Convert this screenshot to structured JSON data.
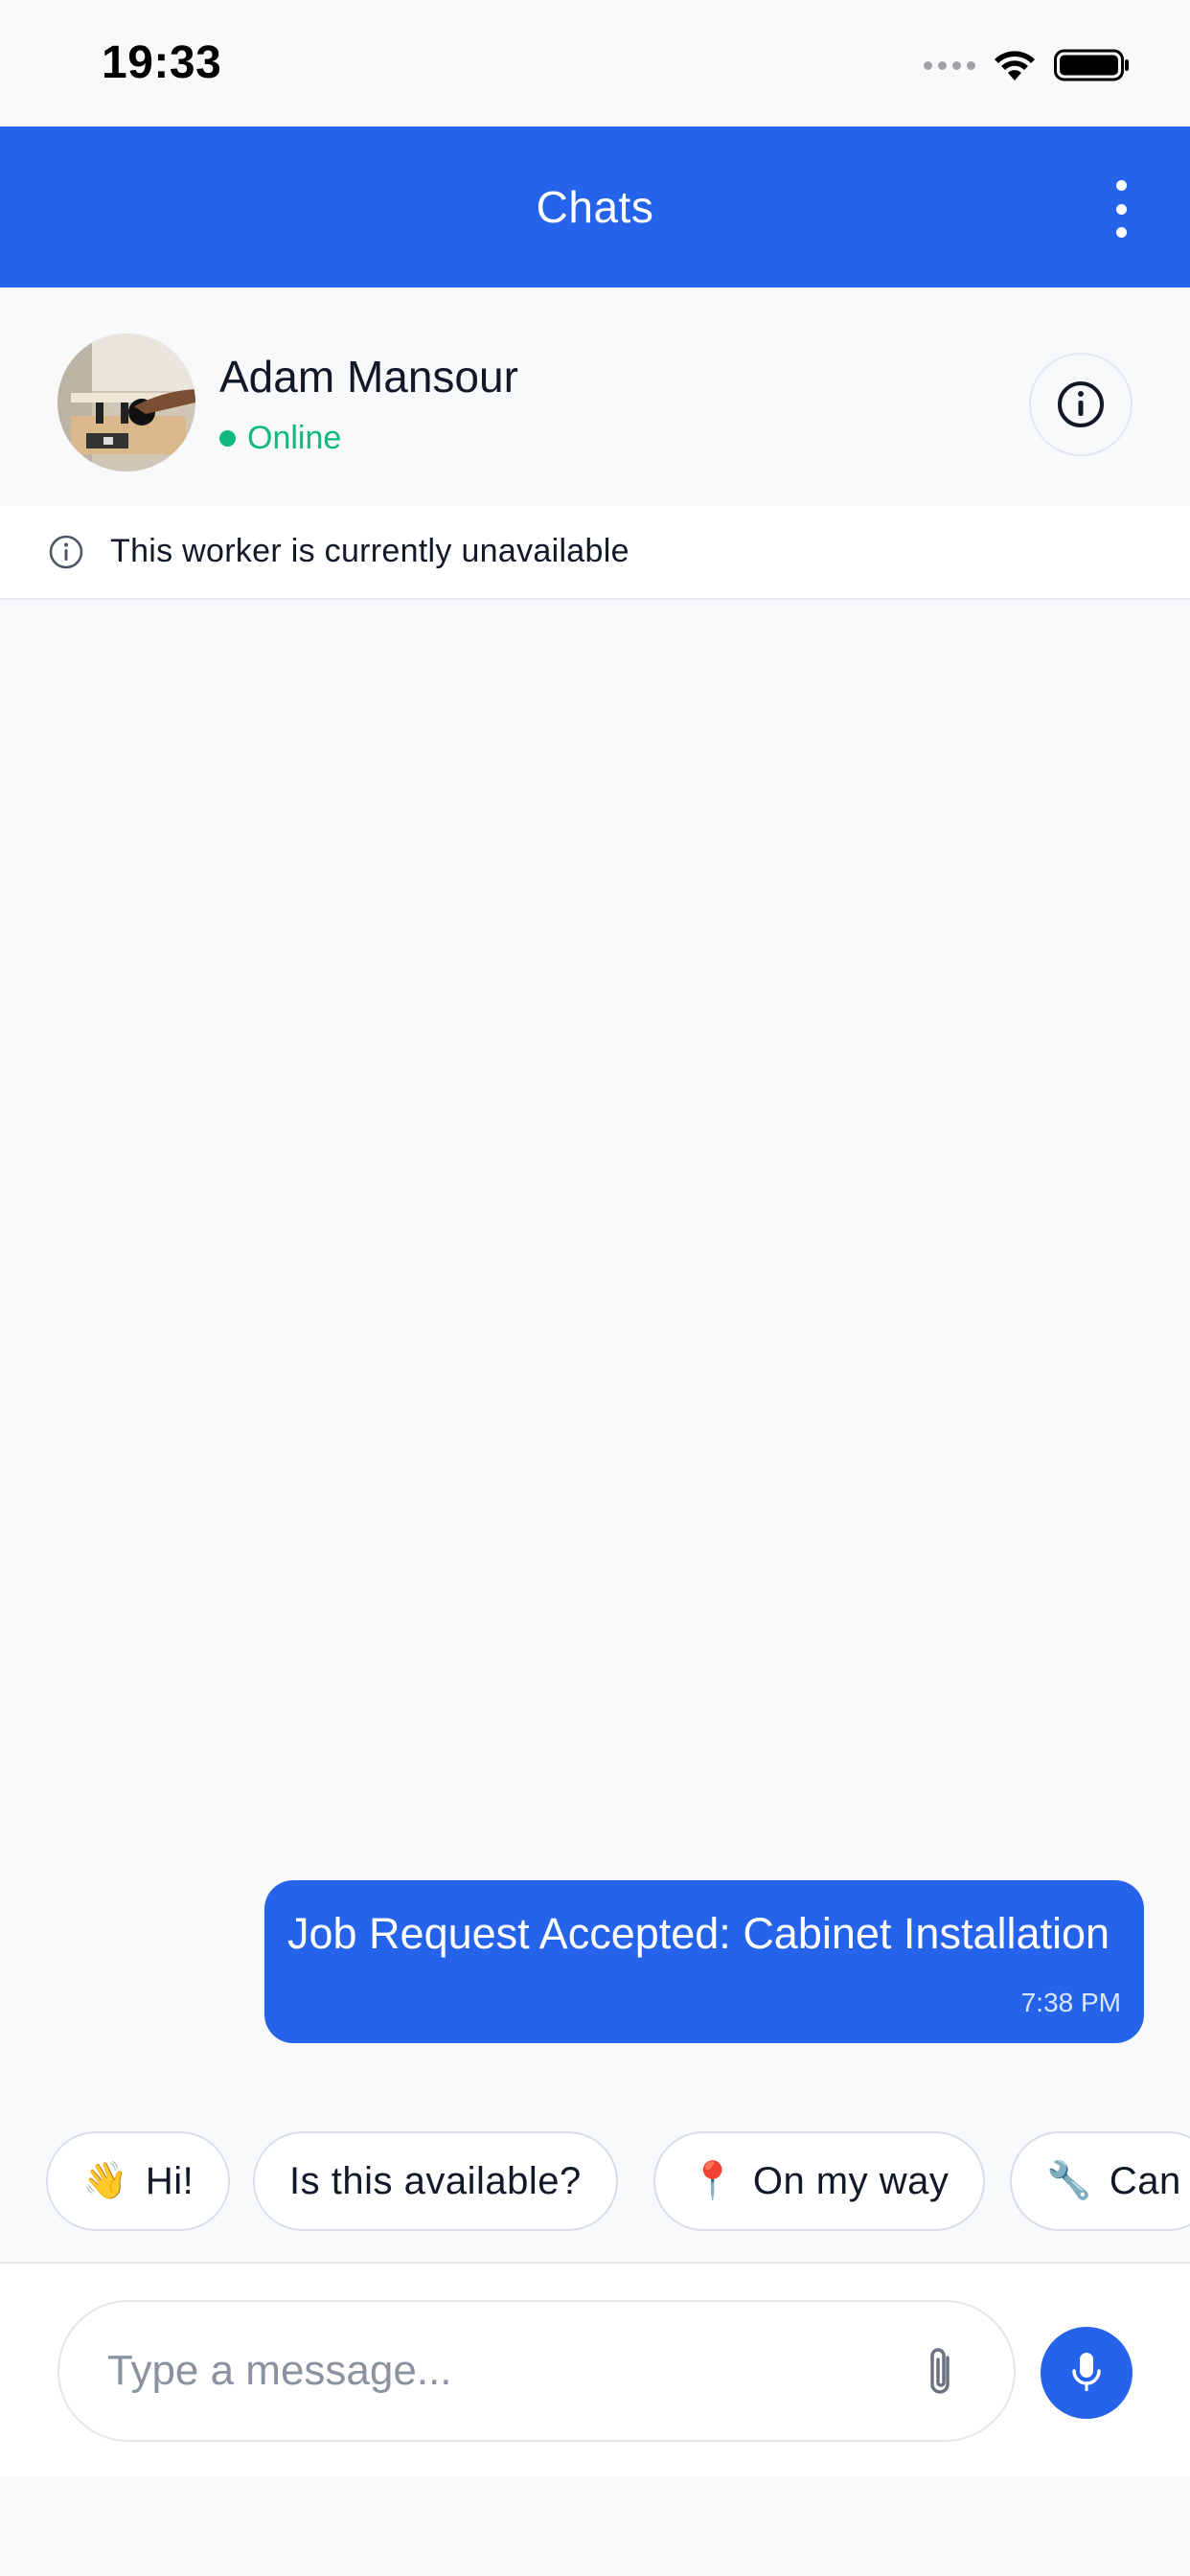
{
  "status_bar": {
    "time": "19:33"
  },
  "header": {
    "title": "Chats",
    "menu_icon": "more-vertical-icon"
  },
  "contact": {
    "name": "Adam Mansour",
    "status": "Online",
    "status_color": "#10b981",
    "info_icon": "info-icon"
  },
  "notice": {
    "text": "This worker is currently unavailable",
    "icon": "info-circle-icon"
  },
  "messages": [
    {
      "text": "Job Request Accepted: Cabinet Installation",
      "time": "7:38 PM",
      "sender": "self"
    }
  ],
  "quick_replies": [
    {
      "emoji": "👋",
      "label": "Hi!"
    },
    {
      "emoji": "",
      "label": "Is this available?"
    },
    {
      "emoji": "📍",
      "label": "On my way"
    },
    {
      "emoji": "🔧",
      "label": "Can"
    }
  ],
  "composer": {
    "placeholder": "Type a message...",
    "attach_icon": "paperclip-icon",
    "mic_icon": "microphone-icon"
  },
  "colors": {
    "accent": "#2563eb",
    "background": "#f8f9fb",
    "online": "#10b981"
  }
}
